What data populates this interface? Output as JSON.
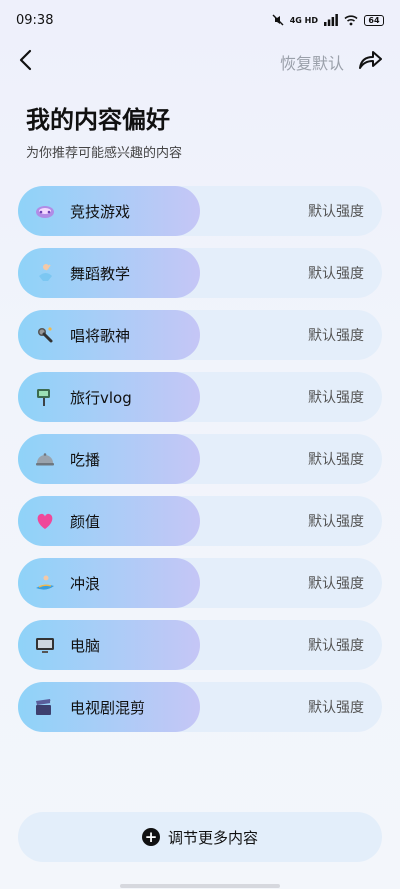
{
  "status": {
    "time": "09:38",
    "network": "4G HD",
    "battery": "64"
  },
  "nav": {
    "restore_label": "恢复默认"
  },
  "header": {
    "title": "我的内容偏好",
    "subtitle": "为你推荐可能感兴趣的内容"
  },
  "items": [
    {
      "label": "竞技游戏",
      "strength": "默认强度",
      "icon": "game-controller-icon"
    },
    {
      "label": "舞蹈教学",
      "strength": "默认强度",
      "icon": "dancer-icon"
    },
    {
      "label": "唱将歌神",
      "strength": "默认强度",
      "icon": "microphone-icon"
    },
    {
      "label": "旅行vlog",
      "strength": "默认强度",
      "icon": "selfie-stick-icon"
    },
    {
      "label": "吃播",
      "strength": "默认强度",
      "icon": "food-dome-icon"
    },
    {
      "label": "颜值",
      "strength": "默认强度",
      "icon": "heart-icon"
    },
    {
      "label": "冲浪",
      "strength": "默认强度",
      "icon": "surfboard-icon"
    },
    {
      "label": "电脑",
      "strength": "默认强度",
      "icon": "computer-icon"
    },
    {
      "label": "电视剧混剪",
      "strength": "默认强度",
      "icon": "clapperboard-icon"
    }
  ],
  "more": {
    "label": "调节更多内容"
  }
}
